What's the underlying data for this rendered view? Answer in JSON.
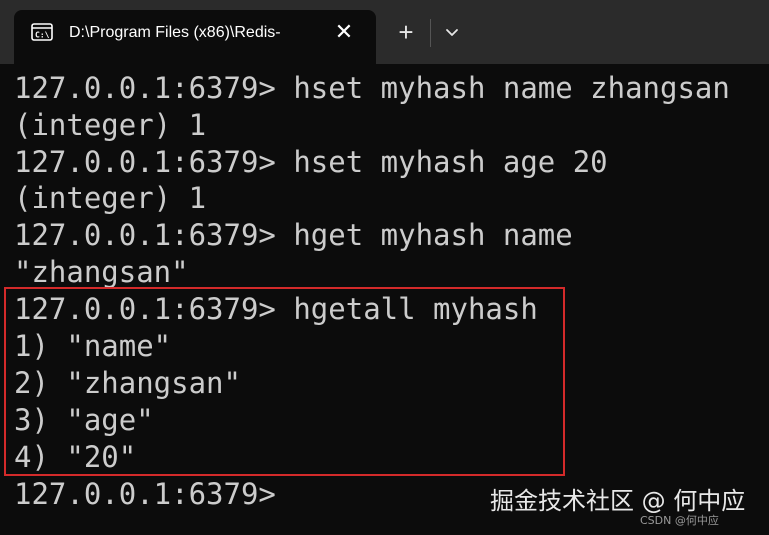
{
  "window": {
    "tab_title": "D:\\Program Files (x86)\\Redis-",
    "close_symbol": "✕",
    "new_tab_symbol": "+",
    "tab_icon": "terminal-icon",
    "dropdown_icon": "chevron-down-icon"
  },
  "terminal": {
    "lines": [
      "127.0.0.1:6379> hset myhash name zhangsan",
      "(integer) 1",
      "127.0.0.1:6379> hset myhash age 20",
      "(integer) 1",
      "127.0.0.1:6379> hget myhash name",
      "\"zhangsan\"",
      "127.0.0.1:6379> hgetall myhash",
      "1) \"name\"",
      "2) \"zhangsan\"",
      "3) \"age\"",
      "4) \"20\"",
      "127.0.0.1:6379>"
    ]
  },
  "watermark": {
    "main": "掘金技术社区 @ 何中应",
    "small": "CSDN @何中应"
  },
  "colors": {
    "background": "#0c0c0c",
    "titlebar": "#2b2b2b",
    "text": "#cccccc",
    "highlight_border": "#d42a2a"
  }
}
